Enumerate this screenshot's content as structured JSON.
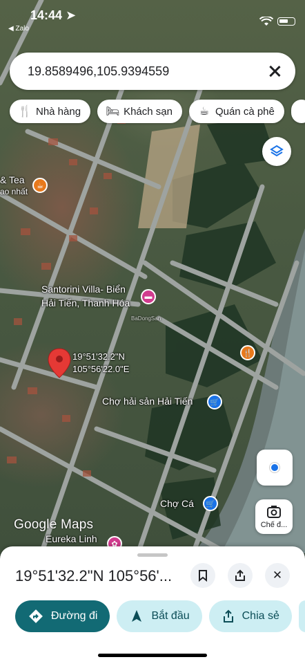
{
  "status_bar": {
    "time": "14:44",
    "back_app": "◀ Zalo"
  },
  "search": {
    "query": "19.8589496,105.9394559"
  },
  "chips": [
    {
      "label": "Nhà hàng",
      "icon": "fork-knife-icon"
    },
    {
      "label": "Khách sạn",
      "icon": "bed-icon"
    },
    {
      "label": "Quán cà phê",
      "icon": "coffee-icon"
    }
  ],
  "map": {
    "labels": {
      "cafe_top": "& Tea",
      "cafe_sub": "ao nhất",
      "villa_line1": "Santorini Villa- Biển",
      "villa_line2": "Hải Tiến, Thanh Hóa",
      "pin_line1": "19°51'32.2\"N",
      "pin_line2": "105°56'22.0\"E",
      "seafood_market": "Chợ hải sản Hải Tiến",
      "fish_market": "Chợ Cá",
      "eureka": "Eureka Linh",
      "watermark": "BaDongSan"
    },
    "google_logo": "Google Maps",
    "screenshot_label": "Chế đ..."
  },
  "sheet": {
    "title": "19°51'32.2\"N 105°56'...",
    "actions": [
      {
        "label": "Đường đi",
        "icon": "directions-icon"
      },
      {
        "label": "Bắt đầu",
        "icon": "navigation-arrow-icon"
      },
      {
        "label": "Chia sẻ",
        "icon": "share-icon"
      }
    ]
  },
  "colors": {
    "primary": "#126a74",
    "secondary": "#cdeef3",
    "pin": "#e53935",
    "accent": "#1a73e8"
  }
}
